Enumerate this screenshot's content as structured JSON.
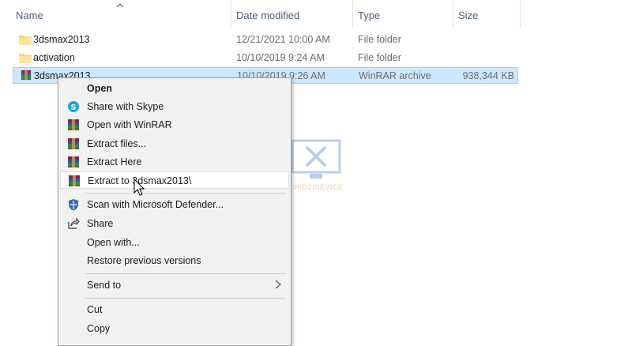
{
  "columns": {
    "name": "Name",
    "date": "Date modified",
    "type": "Type",
    "size": "Size"
  },
  "files": [
    {
      "name": "3dsmax2013",
      "date": "12/21/2021 10:00 AM",
      "type": "File folder",
      "size": "",
      "icon": "folder-icon"
    },
    {
      "name": "activation",
      "date": "10/10/2019 9:24 AM",
      "type": "File folder",
      "size": "",
      "icon": "folder-icon"
    },
    {
      "name": "3dsmax2013",
      "date": "10/10/2019 9:26 AM",
      "type": "WinRAR archive",
      "size": "938,344 KB",
      "icon": "winrar-icon",
      "selected": true
    }
  ],
  "context_menu": {
    "open": "Open",
    "share_skype": "Share with Skype",
    "open_winrar": "Open with WinRAR",
    "extract_files": "Extract files...",
    "extract_here": "Extract Here",
    "extract_to": "Extract to 3dsmax2013\\",
    "scan_defender": "Scan with Microsoft Defender...",
    "share": "Share",
    "open_with": "Open with...",
    "restore_versions": "Restore previous versions",
    "send_to": "Send to",
    "cut": "Cut",
    "copy": "Copy"
  },
  "watermark": {
    "text": "CHIDZISEVICE"
  },
  "colors": {
    "selection": "#cce8ff",
    "selection_border": "#99d1ff",
    "menu_bg": "#f2f2f2",
    "header_text": "#4c607a"
  }
}
